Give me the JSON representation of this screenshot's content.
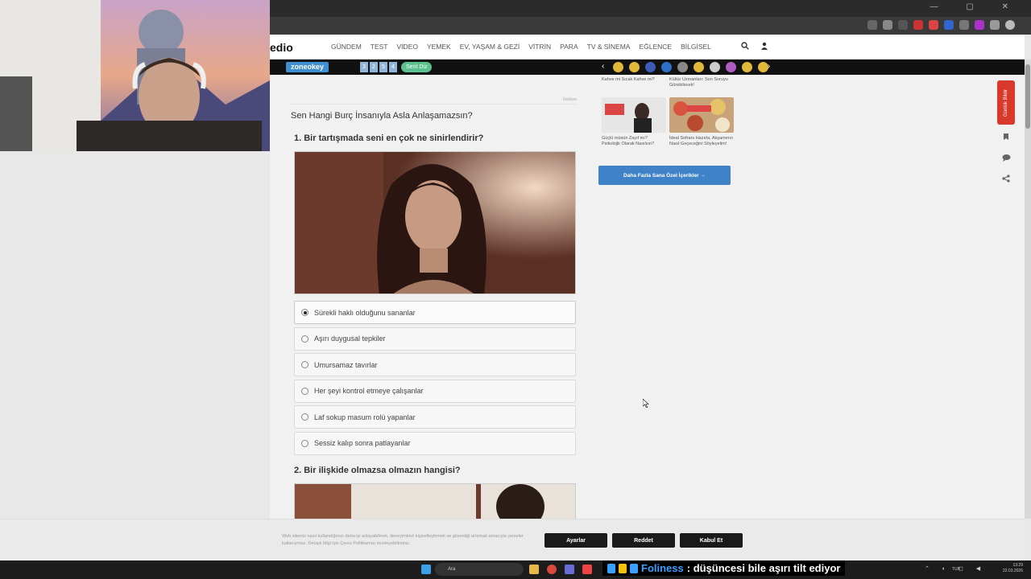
{
  "window": {
    "controls": "— ▢ ✕"
  },
  "site": {
    "logo": "edio",
    "nav": [
      "GÜNDEM",
      "TEST",
      "VİDEO",
      "YEMEK",
      "EV, YAŞAM & GEZİ",
      "VİTRİN",
      "PARA",
      "TV & SİNEMA",
      "EĞLENCE",
      "BİLGİSEL"
    ],
    "search_icon": "search-icon",
    "user_icon": "user-icon"
  },
  "strip": {
    "zone_logo": "zoneokey",
    "numbers": [
      "3",
      "2",
      "5",
      "4"
    ],
    "serit_label": "Serit Diz",
    "emoji_colors": [
      "#e0b83a",
      "#e0b83a",
      "#3b5bb5",
      "#2f6fc7",
      "#888888",
      "#e0b83a",
      "#cccccc",
      "#b05bc0",
      "#e0b83a",
      "#e0b83a"
    ]
  },
  "ad": {
    "label": "Reklam"
  },
  "quiz": {
    "title": "Sen Hangi Burç İnsanıyla Asla Anlaşamazsın?",
    "q1": "1. Bir tartışmada seni en çok ne sinirlendirir?",
    "options": [
      "Sürekli haklı olduğunu sananlar",
      "Aşırı duygusal tepkiler",
      "Umursamaz tavırlar",
      "Her şeyi kontrol etmeye çalışanlar",
      "Laf sokup masum rolü yapanlar",
      "Sessiz kalıp sonra patlayanlar"
    ],
    "q2": "2. Bir ilişkide olmazsa olmazın hangisi?"
  },
  "side": {
    "card_top_left": "Kahve mi Sıcak Kahve mi?",
    "card_top_right": "Kültür Uzmanları: Son Soruyu Görebilecek!",
    "card_left": "Güçlü müsün Zayıf mı? Psikolojik Olarak Nasılsın?",
    "card_right": "İdeal Sofranı Hazırla, Akşamının Nasıl Geçeceğini Söyleyelim!",
    "more_button": "Daha Fazla Sana Özel İçerikler →"
  },
  "rail": {
    "red_tab": "Günlük Bildir"
  },
  "cookie": {
    "text": "Web sitemiz nasıl kullandığınızı daha iyi anlayabilmek, deneyiminizi kişiselleştirmek ve güvenliği artırmak amacıyla çerezler kullanıyoruz. Detaylı bilgi için Çerez Politikamızı inceleyebilirsiniz.",
    "settings": "Ayarlar",
    "reject": "Reddet",
    "accept": "Kabul Et"
  },
  "taskbar": {
    "search": "Ara",
    "lang": "TUR",
    "time": "13:29",
    "date": "22.03.2026"
  },
  "overlay": {
    "user": "Foliness",
    "message": ": düşüncesi bile aşırı tilt ediyor"
  }
}
